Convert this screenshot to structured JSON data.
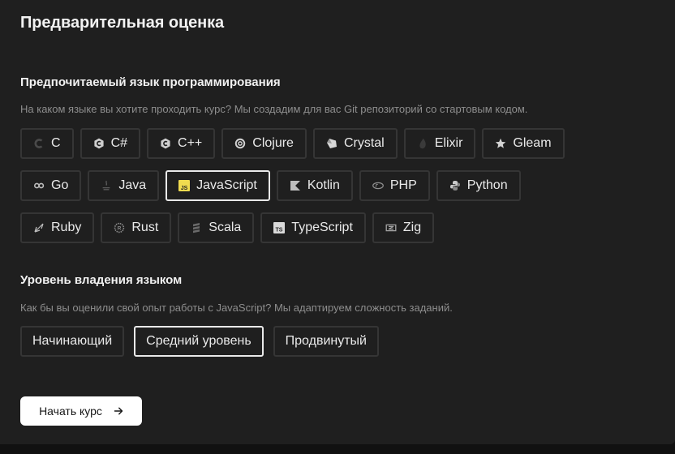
{
  "page": {
    "title": "Предварительная оценка"
  },
  "language_section": {
    "title": "Предпочитаемый язык программирования",
    "description": "На каком языке вы хотите проходить курс? Мы создадим для вас Git репозиторий со стартовым кодом.",
    "selected": "JavaScript",
    "languages": [
      {
        "label": "C",
        "icon": "c-icon"
      },
      {
        "label": "C#",
        "icon": "csharp-icon"
      },
      {
        "label": "C++",
        "icon": "cpp-icon"
      },
      {
        "label": "Clojure",
        "icon": "clojure-icon"
      },
      {
        "label": "Crystal",
        "icon": "crystal-icon"
      },
      {
        "label": "Elixir",
        "icon": "elixir-icon"
      },
      {
        "label": "Gleam",
        "icon": "gleam-star-icon"
      },
      {
        "label": "Go",
        "icon": "go-icon"
      },
      {
        "label": "Java",
        "icon": "java-icon"
      },
      {
        "label": "JavaScript",
        "icon": "javascript-icon"
      },
      {
        "label": "Kotlin",
        "icon": "kotlin-icon"
      },
      {
        "label": "PHP",
        "icon": "php-icon"
      },
      {
        "label": "Python",
        "icon": "python-icon"
      },
      {
        "label": "Ruby",
        "icon": "ruby-icon"
      },
      {
        "label": "Rust",
        "icon": "rust-icon"
      },
      {
        "label": "Scala",
        "icon": "scala-icon"
      },
      {
        "label": "TypeScript",
        "icon": "typescript-icon"
      },
      {
        "label": "Zig",
        "icon": "zig-icon"
      }
    ]
  },
  "level_section": {
    "title": "Уровень владения языком",
    "description": "Как бы вы оценили свой опыт работы с JavaScript? Мы адаптируем сложность заданий.",
    "selected": "Средний уровень",
    "levels": [
      {
        "label": "Начинающий"
      },
      {
        "label": "Средний уровень"
      },
      {
        "label": "Продвинутый"
      }
    ]
  },
  "start_button": {
    "label": "Начать курс",
    "icon": "arrow-right-icon"
  },
  "colors": {
    "page_background": "#111111",
    "card_background": "#1f1f1f",
    "chip_border": "#353535",
    "selected_border": "#e9e9e9",
    "muted_text": "#8d8d8d",
    "javascript_yellow": "#f0db4f"
  }
}
